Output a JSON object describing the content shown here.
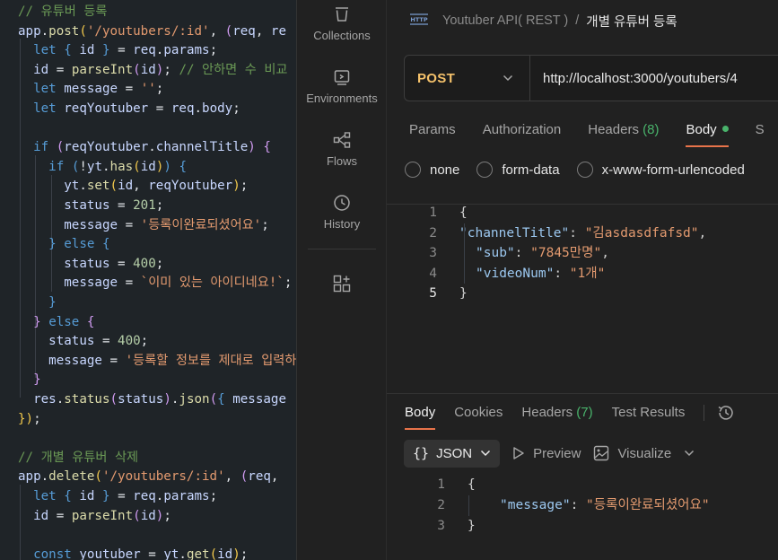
{
  "editor": {
    "lines": [
      [
        [
          "c-cm",
          "// 유튜버 등록"
        ]
      ],
      [
        [
          "c-vr",
          "app"
        ],
        [
          "c-op",
          "."
        ],
        [
          "c-fn",
          "post"
        ],
        [
          "c-pr",
          "("
        ],
        [
          "c-st",
          "'/youtubers/:id'"
        ],
        [
          "c-op",
          ", "
        ],
        [
          "c-pb",
          "("
        ],
        [
          "c-vr",
          "req"
        ],
        [
          "c-op",
          ", "
        ],
        [
          "c-vr",
          "re"
        ]
      ],
      [
        [
          "c-op",
          "  "
        ],
        [
          "c-kw",
          "let"
        ],
        [
          "c-op",
          " "
        ],
        [
          "c-kw",
          "{"
        ],
        [
          "c-op",
          " "
        ],
        [
          "c-vr",
          "id"
        ],
        [
          "c-op",
          " "
        ],
        [
          "c-kw",
          "}"
        ],
        [
          "c-op",
          " = "
        ],
        [
          "c-vr",
          "req"
        ],
        [
          "c-op",
          "."
        ],
        [
          "c-vr",
          "params"
        ],
        [
          "c-op",
          ";"
        ]
      ],
      [
        [
          "c-op",
          "  "
        ],
        [
          "c-vr",
          "id"
        ],
        [
          "c-op",
          " = "
        ],
        [
          "c-fn",
          "parseInt"
        ],
        [
          "c-pb",
          "("
        ],
        [
          "c-vr",
          "id"
        ],
        [
          "c-pb",
          ")"
        ],
        [
          "c-op",
          "; "
        ],
        [
          "c-cm",
          "// 안하면 수 비교"
        ]
      ],
      [
        [
          "c-op",
          "  "
        ],
        [
          "c-kw",
          "let"
        ],
        [
          "c-op",
          " "
        ],
        [
          "c-vr",
          "message"
        ],
        [
          "c-op",
          " = "
        ],
        [
          "c-st",
          "''"
        ],
        [
          "c-op",
          ";"
        ]
      ],
      [
        [
          "c-op",
          "  "
        ],
        [
          "c-kw",
          "let"
        ],
        [
          "c-op",
          " "
        ],
        [
          "c-vr",
          "reqYoutuber"
        ],
        [
          "c-op",
          " = "
        ],
        [
          "c-vr",
          "req"
        ],
        [
          "c-op",
          "."
        ],
        [
          "c-vr",
          "body"
        ],
        [
          "c-op",
          ";"
        ]
      ],
      [],
      [
        [
          "c-op",
          "  "
        ],
        [
          "c-kw",
          "if"
        ],
        [
          "c-op",
          " "
        ],
        [
          "c-pb",
          "("
        ],
        [
          "c-vr",
          "reqYoutuber"
        ],
        [
          "c-op",
          "."
        ],
        [
          "c-vr",
          "channelTitle"
        ],
        [
          "c-pb",
          ")"
        ],
        [
          "c-op",
          " "
        ],
        [
          "c-pb",
          "{"
        ]
      ],
      [
        [
          "c-op",
          "    "
        ],
        [
          "c-kw",
          "if"
        ],
        [
          "c-op",
          " "
        ],
        [
          "c-kw",
          "("
        ],
        [
          "c-op",
          "!"
        ],
        [
          "c-vr",
          "yt"
        ],
        [
          "c-op",
          "."
        ],
        [
          "c-fn",
          "has"
        ],
        [
          "c-pr",
          "("
        ],
        [
          "c-vr",
          "id"
        ],
        [
          "c-pr",
          ")"
        ],
        [
          "c-kw",
          ")"
        ],
        [
          "c-op",
          " "
        ],
        [
          "c-kw",
          "{"
        ]
      ],
      [
        [
          "c-op",
          "      "
        ],
        [
          "c-vr",
          "yt"
        ],
        [
          "c-op",
          "."
        ],
        [
          "c-fn",
          "set"
        ],
        [
          "c-pr",
          "("
        ],
        [
          "c-vr",
          "id"
        ],
        [
          "c-op",
          ", "
        ],
        [
          "c-vr",
          "reqYoutuber"
        ],
        [
          "c-pr",
          ")"
        ],
        [
          "c-op",
          ";"
        ]
      ],
      [
        [
          "c-op",
          "      "
        ],
        [
          "c-vr",
          "status"
        ],
        [
          "c-op",
          " = "
        ],
        [
          "c-nm",
          "201"
        ],
        [
          "c-op",
          ";"
        ]
      ],
      [
        [
          "c-op",
          "      "
        ],
        [
          "c-vr",
          "message"
        ],
        [
          "c-op",
          " = "
        ],
        [
          "c-st",
          "'등록이완료되셨어요'"
        ],
        [
          "c-op",
          ";"
        ]
      ],
      [
        [
          "c-op",
          "    "
        ],
        [
          "c-kw",
          "}"
        ],
        [
          "c-op",
          " "
        ],
        [
          "c-kw",
          "else"
        ],
        [
          "c-op",
          " "
        ],
        [
          "c-kw",
          "{"
        ]
      ],
      [
        [
          "c-op",
          "      "
        ],
        [
          "c-vr",
          "status"
        ],
        [
          "c-op",
          " = "
        ],
        [
          "c-nm",
          "400"
        ],
        [
          "c-op",
          ";"
        ]
      ],
      [
        [
          "c-op",
          "      "
        ],
        [
          "c-vr",
          "message"
        ],
        [
          "c-op",
          " = "
        ],
        [
          "c-st",
          "`이미 있는 아이디네요!`"
        ],
        [
          "c-op",
          ";"
        ]
      ],
      [
        [
          "c-op",
          "    "
        ],
        [
          "c-kw",
          "}"
        ]
      ],
      [
        [
          "c-op",
          "  "
        ],
        [
          "c-pb",
          "}"
        ],
        [
          "c-op",
          " "
        ],
        [
          "c-kw",
          "else"
        ],
        [
          "c-op",
          " "
        ],
        [
          "c-pb",
          "{"
        ]
      ],
      [
        [
          "c-op",
          "    "
        ],
        [
          "c-vr",
          "status"
        ],
        [
          "c-op",
          " = "
        ],
        [
          "c-nm",
          "400"
        ],
        [
          "c-op",
          ";"
        ]
      ],
      [
        [
          "c-op",
          "    "
        ],
        [
          "c-vr",
          "message"
        ],
        [
          "c-op",
          " = "
        ],
        [
          "c-st",
          "'등록할 정보를 제대로 입력하"
        ]
      ],
      [
        [
          "c-op",
          "  "
        ],
        [
          "c-pb",
          "}"
        ]
      ],
      [
        [
          "c-op",
          "  "
        ],
        [
          "c-vr",
          "res"
        ],
        [
          "c-op",
          "."
        ],
        [
          "c-fn",
          "status"
        ],
        [
          "c-pb",
          "("
        ],
        [
          "c-vr",
          "status"
        ],
        [
          "c-pb",
          ")"
        ],
        [
          "c-op",
          "."
        ],
        [
          "c-fn",
          "json"
        ],
        [
          "c-pb",
          "("
        ],
        [
          "c-kw",
          "{"
        ],
        [
          "c-op",
          " "
        ],
        [
          "c-vr",
          "message"
        ]
      ],
      [
        [
          "c-pr",
          "}"
        ],
        [
          "c-pr",
          ")"
        ],
        [
          "c-op",
          ";"
        ]
      ],
      [],
      [
        [
          "c-cm",
          "// 개별 유튜버 삭제"
        ]
      ],
      [
        [
          "c-vr",
          "app"
        ],
        [
          "c-op",
          "."
        ],
        [
          "c-fn",
          "delete"
        ],
        [
          "c-pr",
          "("
        ],
        [
          "c-st",
          "'/youtubers/:id'"
        ],
        [
          "c-op",
          ", "
        ],
        [
          "c-pb",
          "("
        ],
        [
          "c-vr",
          "req"
        ],
        [
          "c-op",
          ","
        ]
      ],
      [
        [
          "c-op",
          "  "
        ],
        [
          "c-kw",
          "let"
        ],
        [
          "c-op",
          " "
        ],
        [
          "c-kw",
          "{"
        ],
        [
          "c-op",
          " "
        ],
        [
          "c-vr",
          "id"
        ],
        [
          "c-op",
          " "
        ],
        [
          "c-kw",
          "}"
        ],
        [
          "c-op",
          " = "
        ],
        [
          "c-vr",
          "req"
        ],
        [
          "c-op",
          "."
        ],
        [
          "c-vr",
          "params"
        ],
        [
          "c-op",
          ";"
        ]
      ],
      [
        [
          "c-op",
          "  "
        ],
        [
          "c-vr",
          "id"
        ],
        [
          "c-op",
          " = "
        ],
        [
          "c-fn",
          "parseInt"
        ],
        [
          "c-pb",
          "("
        ],
        [
          "c-vr",
          "id"
        ],
        [
          "c-pb",
          ")"
        ],
        [
          "c-op",
          ";"
        ]
      ],
      [],
      [
        [
          "c-op",
          "  "
        ],
        [
          "c-kw",
          "const"
        ],
        [
          "c-op",
          " "
        ],
        [
          "c-vr",
          "youtuber"
        ],
        [
          "c-op",
          " = "
        ],
        [
          "c-vr",
          "yt"
        ],
        [
          "c-op",
          "."
        ],
        [
          "c-fn",
          "get"
        ],
        [
          "c-pr",
          "("
        ],
        [
          "c-vr",
          "id"
        ],
        [
          "c-pr",
          ")"
        ],
        [
          "c-op",
          ";"
        ]
      ]
    ]
  },
  "sidebar": {
    "collections": "Collections",
    "environments": "Environments",
    "flows": "Flows",
    "history": "History",
    "icons": [
      "collections-icon",
      "environments-icon",
      "flows-icon",
      "history-icon",
      "configure-workbench-icon"
    ]
  },
  "breadcrumb": {
    "collection": "Youtuber API( REST )",
    "separator": "/",
    "request": "개별 유튜버 등록"
  },
  "request": {
    "method": "POST",
    "url": "http://localhost:3000/youtubers/4",
    "tabs": {
      "params": "Params",
      "authorization": "Authorization",
      "headers": "Headers",
      "headers_count": "(8)",
      "body": "Body",
      "settings": "S"
    },
    "body_types": {
      "none": "none",
      "form_data": "form-data",
      "urlencoded": "x-www-form-urlencoded"
    },
    "body_lines": [
      {
        "n": "1",
        "segs": [
          [
            "j-pun",
            "{"
          ]
        ]
      },
      {
        "n": "2",
        "segs": [
          [
            "j-key",
            "\"channelTitle\""
          ],
          [
            "j-pun",
            ": "
          ],
          [
            "j-str",
            "\"김asdasdfafsd\""
          ],
          [
            "j-pun",
            ","
          ]
        ]
      },
      {
        "n": "3",
        "segs": [
          [
            "j-key",
            "\"sub\""
          ],
          [
            "j-pun",
            ": "
          ],
          [
            "j-str",
            "\"7845만명\""
          ],
          [
            "j-pun",
            ","
          ]
        ]
      },
      {
        "n": "4",
        "segs": [
          [
            "j-key",
            "\"videoNum\""
          ],
          [
            "j-pun",
            ": "
          ],
          [
            "j-str",
            "\"1개\""
          ]
        ]
      },
      {
        "n": "5",
        "segs": [
          [
            "j-pun",
            "}"
          ]
        ]
      }
    ]
  },
  "response": {
    "tabs": {
      "body": "Body",
      "cookies": "Cookies",
      "headers": "Headers",
      "headers_count": "(7)",
      "test_results": "Test Results"
    },
    "format": "JSON",
    "preview": "Preview",
    "visualize": "Visualize",
    "lines": [
      {
        "n": "1",
        "segs": [
          [
            "j-pun",
            "{"
          ]
        ]
      },
      {
        "n": "2",
        "segs": [
          [
            "j-key",
            "\"message\""
          ],
          [
            "j-pun",
            ": "
          ],
          [
            "j-str",
            "\"등록이완료되셨어요\""
          ]
        ]
      },
      {
        "n": "3",
        "segs": [
          [
            "j-pun",
            "}"
          ]
        ]
      }
    ]
  },
  "colors": {
    "accent": "#e8734a",
    "post_method": "#f5c26b",
    "count_green": "#49b36b"
  }
}
